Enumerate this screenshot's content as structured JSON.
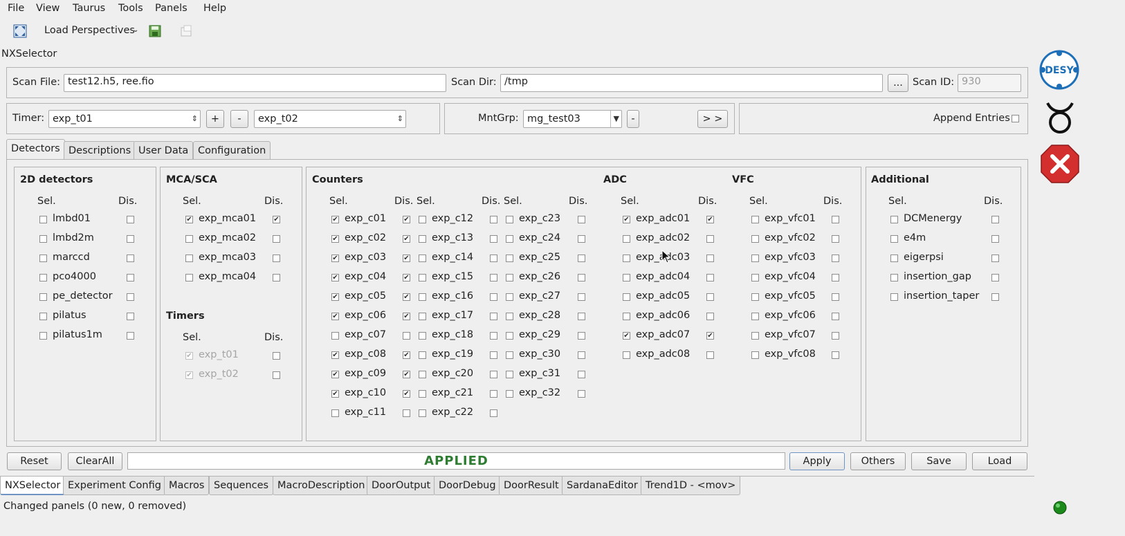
{
  "menu": [
    "File",
    "View",
    "Taurus",
    "Tools",
    "Panels",
    "Help"
  ],
  "toolbar": {
    "perspectives_label": "Load Perspectives"
  },
  "window_title": "NXSelector",
  "scan": {
    "file_label": "Scan File:",
    "file_value": "test12.h5, ree.fio",
    "dir_label": "Scan Dir:",
    "dir_value": "/tmp",
    "browse_label": "...",
    "id_label": "Scan ID:",
    "id_value": "930"
  },
  "timer": {
    "label": "Timer:",
    "value": "exp_t01",
    "plus": "+",
    "minus": "-",
    "second": "exp_t02"
  },
  "mntgrp": {
    "label": "MntGrp:",
    "value": "mg_test03",
    "minus": "-",
    "forward": "> >"
  },
  "append": {
    "label": "Append Entries"
  },
  "tabs": [
    "Detectors",
    "Descriptions",
    "User Data",
    "Configuration"
  ],
  "headers": {
    "sel": "Sel.",
    "dis": "Dis."
  },
  "detectors2d": {
    "title": "2D detectors",
    "items": [
      "lmbd01",
      "lmbd2m",
      "marccd",
      "pco4000",
      "pe_detector",
      "pilatus",
      "pilatus1m"
    ]
  },
  "mca": {
    "title": "MCA/SCA",
    "items": [
      "exp_mca01",
      "exp_mca02",
      "exp_mca03",
      "exp_mca04"
    ]
  },
  "timers": {
    "title": "Timers",
    "items": [
      "exp_t01",
      "exp_t02"
    ]
  },
  "counters": {
    "title": "Counters",
    "col1": [
      "exp_c01",
      "exp_c02",
      "exp_c03",
      "exp_c04",
      "exp_c05",
      "exp_c06",
      "exp_c07",
      "exp_c08",
      "exp_c09",
      "exp_c10",
      "exp_c11"
    ],
    "col2": [
      "exp_c12",
      "exp_c13",
      "exp_c14",
      "exp_c15",
      "exp_c16",
      "exp_c17",
      "exp_c18",
      "exp_c19",
      "exp_c20",
      "exp_c21",
      "exp_c22"
    ],
    "col3": [
      "exp_c23",
      "exp_c24",
      "exp_c25",
      "exp_c26",
      "exp_c27",
      "exp_c28",
      "exp_c29",
      "exp_c30",
      "exp_c31",
      "exp_c32"
    ]
  },
  "adc": {
    "title": "ADC",
    "items": [
      "exp_adc01",
      "exp_adc02",
      "exp_adc03",
      "exp_adc04",
      "exp_adc05",
      "exp_adc06",
      "exp_adc07",
      "exp_adc08"
    ]
  },
  "vfc": {
    "title": "VFC",
    "items": [
      "exp_vfc01",
      "exp_vfc02",
      "exp_vfc03",
      "exp_vfc04",
      "exp_vfc05",
      "exp_vfc06",
      "exp_vfc07",
      "exp_vfc08"
    ]
  },
  "additional": {
    "title": "Additional",
    "items": [
      "DCMenergy",
      "e4m",
      "eigerpsi",
      "insertion_gap",
      "insertion_taper"
    ]
  },
  "bottom": {
    "reset": "Reset",
    "clearall": "ClearAll",
    "status": "APPLIED",
    "apply": "Apply",
    "others": "Others",
    "save": "Save",
    "load": "Load"
  },
  "panels": [
    "NXSelector",
    "Experiment Config",
    "Macros",
    "Sequences",
    "MacroDescription",
    "DoorOutput",
    "DoorDebug",
    "DoorResult",
    "SardanaEditor",
    "Trend1D - <mov>"
  ],
  "statusbar": "Changed panels (0 new, 0 removed)",
  "logo_desy": "DESY",
  "colors": {
    "applied": "#2e7d32",
    "close_red": "#d32f2f",
    "desy_blue": "#1d6fb8",
    "led": "#1b8a1b"
  }
}
